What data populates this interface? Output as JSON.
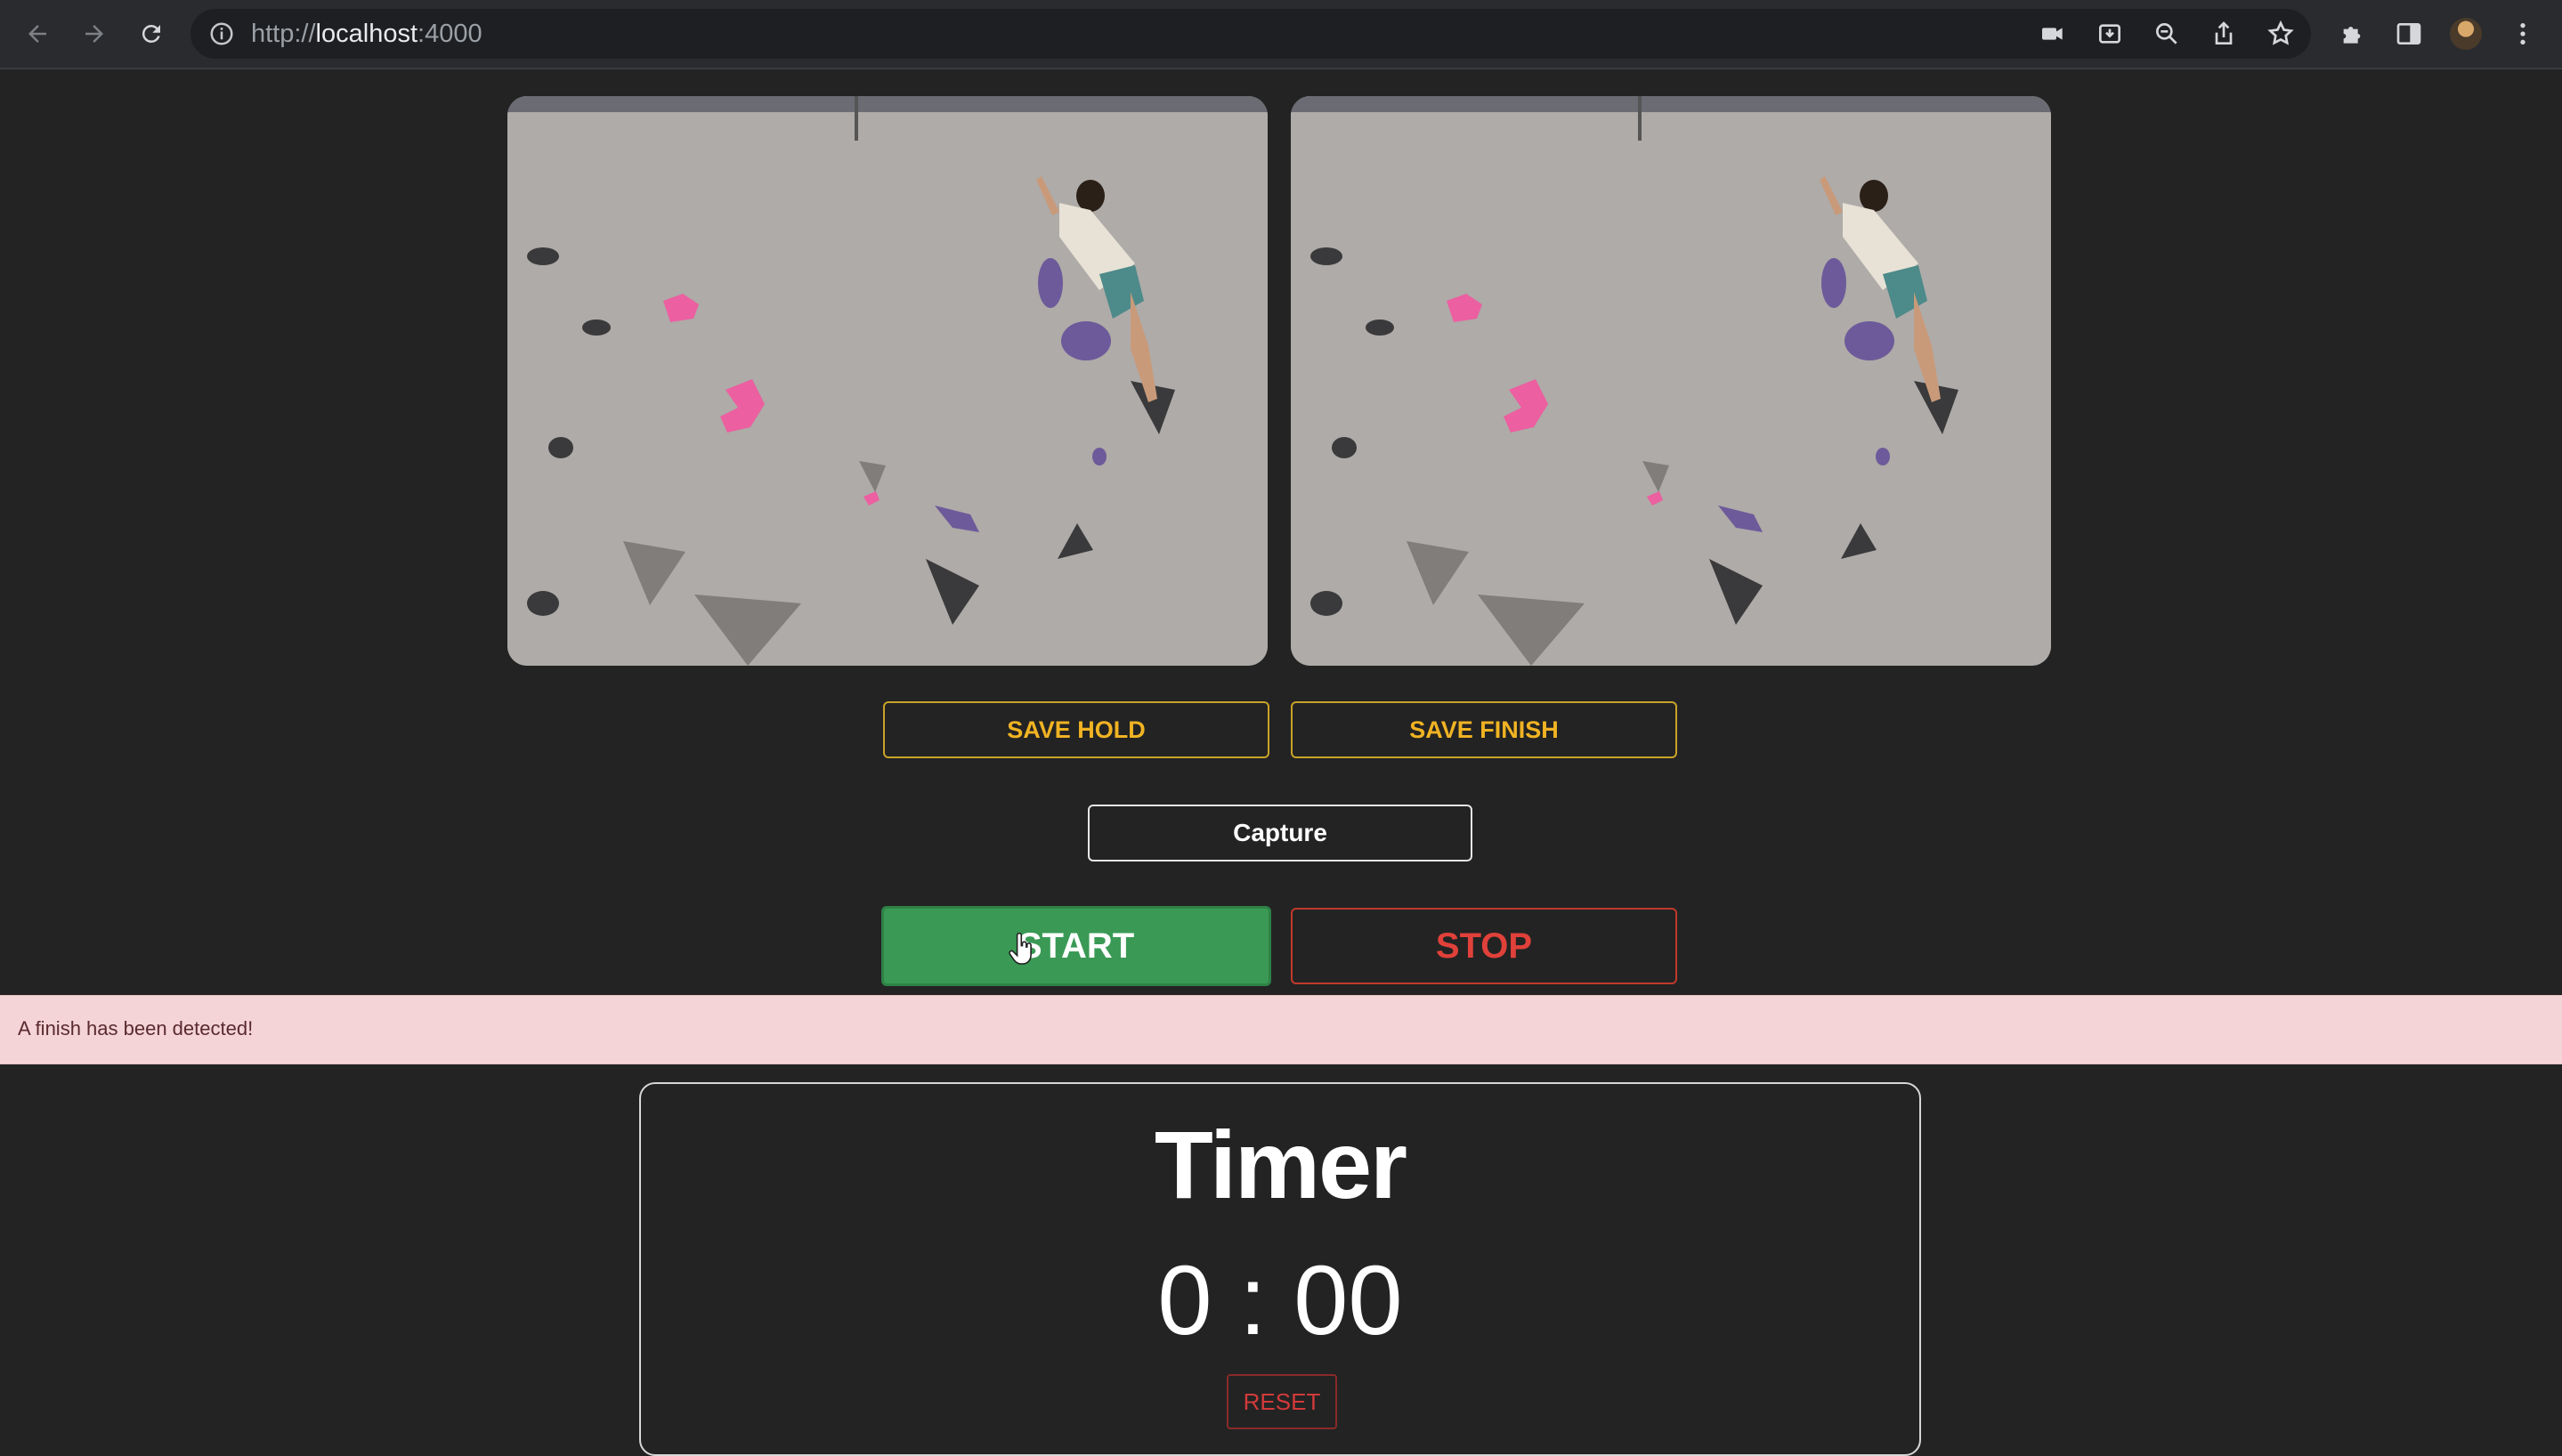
{
  "browser": {
    "url_scheme": "http://",
    "url_host": "localhost",
    "url_port": ":4000"
  },
  "icons": {
    "back": "back-arrow-icon",
    "forward": "forward-arrow-icon",
    "reload": "reload-icon",
    "site_info": "info-icon",
    "camera": "camera-icon",
    "install": "install-icon",
    "zoom": "zoom-out-icon",
    "share": "share-icon",
    "bookmark": "star-icon",
    "extensions": "puzzle-icon",
    "sidepanel": "side-panel-icon",
    "menu": "kebab-menu-icon"
  },
  "controls": {
    "save_hold": "SAVE HOLD",
    "save_finish": "SAVE FINISH",
    "capture": "Capture",
    "start": "START",
    "stop": "STOP"
  },
  "alert": {
    "message": "A finish has been detected!"
  },
  "timer": {
    "title": "Timer",
    "value": "0 : 00",
    "reset": "RESET"
  },
  "colors": {
    "background": "#232323",
    "save_accent": "#f0b323",
    "start_green": "#3a9a55",
    "stop_red": "#e0413a",
    "alert_bg": "#f4d4d7"
  }
}
